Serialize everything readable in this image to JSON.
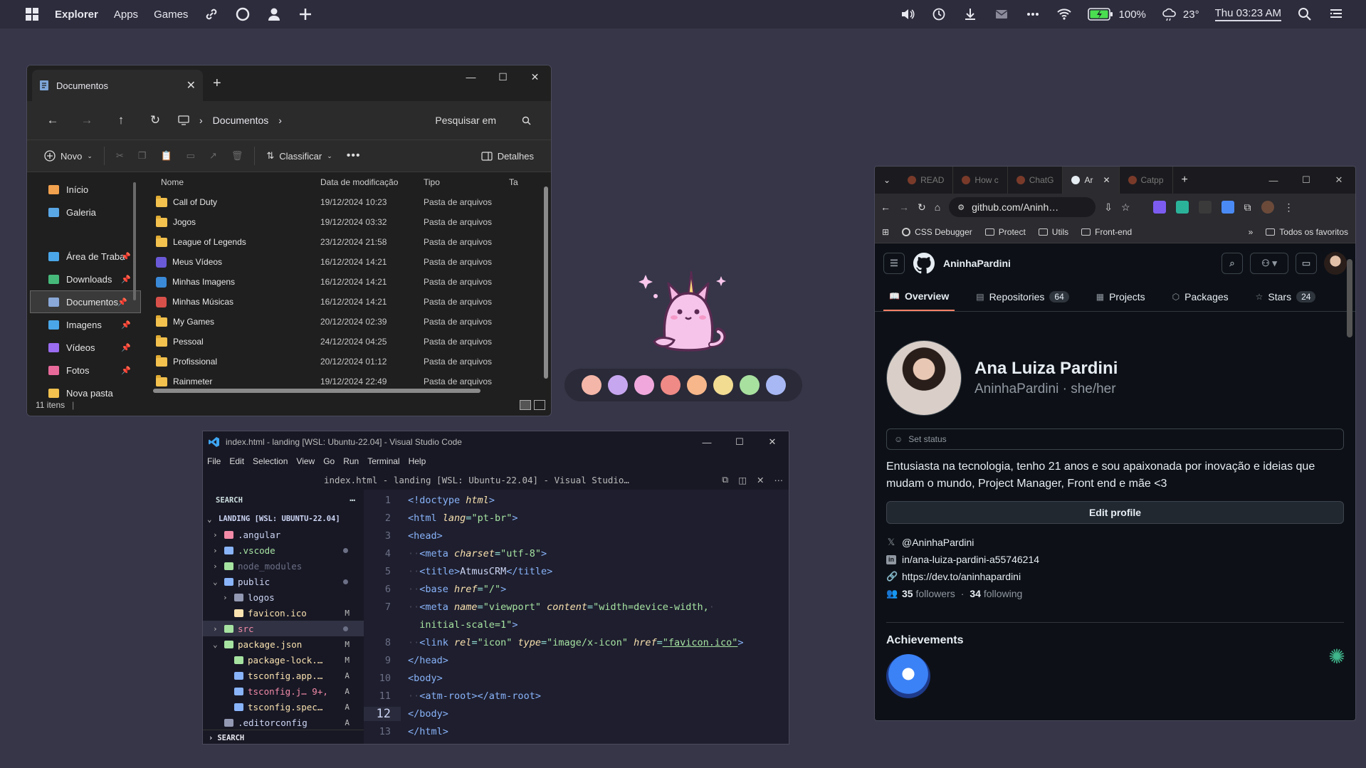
{
  "topbar": {
    "explorer": "Explorer",
    "apps": "Apps",
    "games": "Games",
    "battery": "100%",
    "weather": "23°",
    "clock": "Thu 03:23 AM"
  },
  "explorer": {
    "tab_title": "Documentos",
    "breadcrumb": "Documentos",
    "search_placeholder": "Pesquisar em",
    "cmd_new": "Novo",
    "cmd_sort": "Classificar",
    "cmd_details": "Detalhes",
    "sidebar": [
      {
        "label": "Início",
        "icon": "home-icon",
        "pinned": false
      },
      {
        "label": "Galeria",
        "icon": "gallery-icon",
        "pinned": false
      },
      {
        "label": "Área de Traba",
        "icon": "desktop-icon",
        "pinned": true
      },
      {
        "label": "Downloads",
        "icon": "download-icon",
        "pinned": true
      },
      {
        "label": "Documentos",
        "icon": "document-icon",
        "pinned": true
      },
      {
        "label": "Imagens",
        "icon": "image-icon",
        "pinned": true
      },
      {
        "label": "Vídeos",
        "icon": "video-icon",
        "pinned": true
      },
      {
        "label": "Fotos",
        "icon": "photos-icon",
        "pinned": true
      },
      {
        "label": "Nova pasta",
        "icon": "folder-icon",
        "pinned": false
      }
    ],
    "columns": {
      "name": "Nome",
      "date": "Data de modificação",
      "type": "Tipo",
      "size": "Ta"
    },
    "files": [
      {
        "name": "Call of Duty",
        "date": "19/12/2024 10:23",
        "type": "Pasta de arquivos",
        "kind": "folder"
      },
      {
        "name": "Jogos",
        "date": "19/12/2024 03:32",
        "type": "Pasta de arquivos",
        "kind": "folder"
      },
      {
        "name": "League of Legends",
        "date": "23/12/2024 21:58",
        "type": "Pasta de arquivos",
        "kind": "folder"
      },
      {
        "name": "Meus Vídeos",
        "date": "16/12/2024 14:21",
        "type": "Pasta de arquivos",
        "kind": "video"
      },
      {
        "name": "Minhas Imagens",
        "date": "16/12/2024 14:21",
        "type": "Pasta de arquivos",
        "kind": "image"
      },
      {
        "name": "Minhas Músicas",
        "date": "16/12/2024 14:21",
        "type": "Pasta de arquivos",
        "kind": "music"
      },
      {
        "name": "My Games",
        "date": "20/12/2024 02:39",
        "type": "Pasta de arquivos",
        "kind": "folder"
      },
      {
        "name": "Pessoal",
        "date": "24/12/2024 04:25",
        "type": "Pasta de arquivos",
        "kind": "folder"
      },
      {
        "name": "Profissional",
        "date": "20/12/2024 01:12",
        "type": "Pasta de arquivos",
        "kind": "folder"
      },
      {
        "name": "Rainmeter",
        "date": "19/12/2024 22:49",
        "type": "Pasta de arquivos",
        "kind": "folder"
      }
    ],
    "status": "11 itens"
  },
  "palette": [
    "#f4b6a8",
    "#c7a6f0",
    "#f0a8dc",
    "#f08a86",
    "#f7b78a",
    "#f2dc92",
    "#a8e0a0",
    "#a8b8f4"
  ],
  "vscode": {
    "window_title": "index.html - landing [WSL: Ubuntu-22.04] - Visual Studio Code",
    "menu": [
      "File",
      "Edit",
      "Selection",
      "View",
      "Go",
      "Run",
      "Terminal",
      "Help"
    ],
    "tab_title": "index.html - landing [WSL: Ubuntu-22.04] - Visual Studio…",
    "sidebar_header": "SEARCH",
    "workspace": "LANDING [WSL: UBUNTU-22.04]",
    "tree": [
      {
        "label": ".angular",
        "chev": "›",
        "indent": 1,
        "color": "#cdd6f4",
        "icon": "#f38ba8",
        "status": ""
      },
      {
        "label": ".vscode",
        "chev": "›",
        "indent": 1,
        "color": "#a6e3a1",
        "icon": "#89b4fa",
        "status": "dot"
      },
      {
        "label": "node_modules",
        "chev": "›",
        "indent": 1,
        "color": "#6c7086",
        "icon": "#a6e3a1",
        "status": ""
      },
      {
        "label": "public",
        "chev": "⌄",
        "indent": 1,
        "color": "#cdd6f4",
        "icon": "#89b4fa",
        "status": "dot"
      },
      {
        "label": "logos",
        "chev": "›",
        "indent": 2,
        "color": "#cdd6f4",
        "icon": "#9399b2",
        "status": ""
      },
      {
        "label": "favicon.ico",
        "chev": "",
        "indent": 2,
        "color": "#f9e2af",
        "icon": "#f9e2af",
        "status": "M"
      },
      {
        "label": "src",
        "chev": "›",
        "indent": 1,
        "color": "#f38ba8",
        "icon": "#a6e3a1",
        "status": "dot",
        "sel": true
      },
      {
        "label": "package.json",
        "chev": "⌄",
        "indent": 1,
        "color": "#f9e2af",
        "icon": "#a6e3a1",
        "status": "M"
      },
      {
        "label": "package-lock.…",
        "chev": "",
        "indent": 2,
        "color": "#f9e2af",
        "icon": "#a6e3a1",
        "status": "M"
      },
      {
        "label": "tsconfig.app.…",
        "chev": "",
        "indent": 2,
        "color": "#f9e2af",
        "icon": "#89b4fa",
        "status": "A"
      },
      {
        "label": "tsconfig.j… 9+,",
        "chev": "",
        "indent": 2,
        "color": "#f38ba8",
        "icon": "#89b4fa",
        "status": "A"
      },
      {
        "label": "tsconfig.spec…",
        "chev": "",
        "indent": 2,
        "color": "#f9e2af",
        "icon": "#89b4fa",
        "status": "A"
      },
      {
        "label": ".editorconfig",
        "chev": "",
        "indent": 1,
        "color": "#cdd6f4",
        "icon": "#9399b2",
        "status": "A"
      }
    ],
    "footer": "SEARCH",
    "code": [
      {
        "n": "1",
        "html": "<span class='tag'>&lt;!doctype</span> <span class='attr'>html</span><span class='tag'>&gt;</span>"
      },
      {
        "n": "2",
        "html": "<span class='tag'>&lt;html</span> <span class='attr'>lang</span><span class='pun'>=</span><span class='str'>\"pt-br\"</span><span class='tag'>&gt;</span>"
      },
      {
        "n": "3",
        "html": "<span class='tag'>&lt;head&gt;</span>"
      },
      {
        "n": "4",
        "html": "<span class='ws'>··</span><span class='tag'>&lt;meta</span> <span class='attr'>charset</span><span class='pun'>=</span><span class='str'>\"utf-8\"</span><span class='tag'>&gt;</span>"
      },
      {
        "n": "5",
        "html": "<span class='ws'>··</span><span class='tag'>&lt;title&gt;</span>AtmusCRM<span class='tag'>&lt;/title&gt;</span>"
      },
      {
        "n": "6",
        "html": "<span class='ws'>··</span><span class='tag'>&lt;base</span> <span class='attr'>href</span><span class='pun'>=</span><span class='str'>\"/\"</span><span class='tag'>&gt;</span>"
      },
      {
        "n": "7",
        "html": "<span class='ws'>··</span><span class='tag'>&lt;meta</span> <span class='attr'>name</span><span class='pun'>=</span><span class='str'>\"viewport\"</span> <span class='attr'>content</span><span class='pun'>=</span><span class='str'>\"width=device-width,</span><span class='ws'>·</span>"
      },
      {
        "n": "",
        "html": "<span class='str'>  initial-scale=1\"</span><span class='tag'>&gt;</span>"
      },
      {
        "n": "8",
        "html": "<span class='ws'>··</span><span class='tag'>&lt;link</span> <span class='attr'>rel</span><span class='pun'>=</span><span class='str'>\"icon\"</span> <span class='attr'>type</span><span class='pun'>=</span><span class='str'>\"image/x-icon\"</span> <span class='attr'>href</span><span class='pun'>=</span><span class='str' style='text-decoration:underline'>\"favicon.ico\"</span><span class='tag'>&gt;</span>"
      },
      {
        "n": "9",
        "html": "<span class='tag'>&lt;/head&gt;</span>"
      },
      {
        "n": "10",
        "html": "<span class='tag'>&lt;body&gt;</span>"
      },
      {
        "n": "11",
        "html": "<span class='ws'>··</span><span class='tag'>&lt;atm-root&gt;&lt;/atm-root&gt;</span>"
      },
      {
        "n": "12",
        "html": "<span class='tag'>&lt;/body&gt;</span>",
        "cur": true
      },
      {
        "n": "13",
        "html": "<span class='tag'>&lt;/html&gt;</span>"
      }
    ]
  },
  "browser": {
    "tabs": [
      {
        "label": "READ",
        "active": false
      },
      {
        "label": "How c",
        "active": false
      },
      {
        "label": "ChatG",
        "active": false
      },
      {
        "label": "Ar",
        "active": true
      },
      {
        "label": "Catpp",
        "active": false
      }
    ],
    "url": "github.com/Aninh…",
    "bookmarks": [
      "CSS Debugger",
      "Protect",
      "Utils",
      "Front-end"
    ],
    "all_bookmarks": "Todos os favoritos",
    "github": {
      "user": "AninhaPardini",
      "tabs": [
        {
          "label": "Overview",
          "count": "",
          "active": true
        },
        {
          "label": "Repositories",
          "count": "64",
          "active": false
        },
        {
          "label": "Projects",
          "count": "",
          "active": false
        },
        {
          "label": "Packages",
          "count": "",
          "active": false
        },
        {
          "label": "Stars",
          "count": "24",
          "active": false
        }
      ],
      "name": "Ana Luiza Pardini",
      "login": "AninhaPardini · she/her",
      "set_status": "Set status",
      "bio": "Entusiasta na tecnologia, tenho 21 anos e sou apaixonada por inovação e ideias que mudam o mundo, Project Manager, Front end e mãe <3",
      "edit_profile": "Edit profile",
      "twitter": "@AninhaPardini",
      "linkedin": "in/ana-luiza-pardini-a55746214",
      "website": "https://dev.to/aninhapardini",
      "followers": "35",
      "followers_label": "followers",
      "following": "34",
      "following_label": "following",
      "achievements": "Achievements"
    }
  }
}
